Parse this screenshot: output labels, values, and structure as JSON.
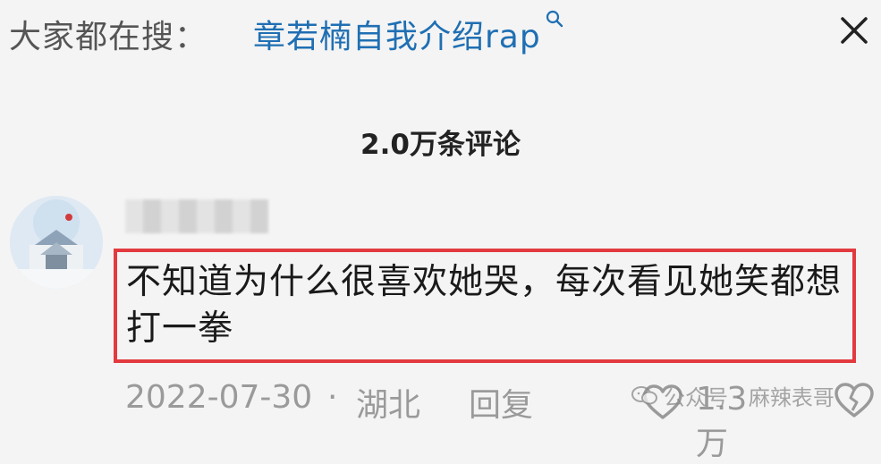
{
  "search_bar": {
    "prefix": "大家都在搜：",
    "query": "章若楠自我介绍rap"
  },
  "comments_header": {
    "count_label": "2.0万条评论"
  },
  "comment": {
    "text": "不知道为什么很喜欢她哭，每次看见她笑都想打一拳",
    "date": "2022-07-30",
    "separator": "·",
    "location": "湖北",
    "reply_label": "回复",
    "like_count": "1.3万"
  },
  "watermark": {
    "text": "公众号 · 麻辣表哥"
  },
  "colors": {
    "background": "#f4f4f4",
    "link_blue": "#1f6fb3",
    "highlight_red": "#e23a3f",
    "meta_gray": "#9a9a9a"
  },
  "icons": {
    "search": "search-icon",
    "close": "close-icon",
    "like": "heart-outline-icon",
    "dislike": "broken-heart-icon",
    "wechat": "wechat-icon"
  }
}
